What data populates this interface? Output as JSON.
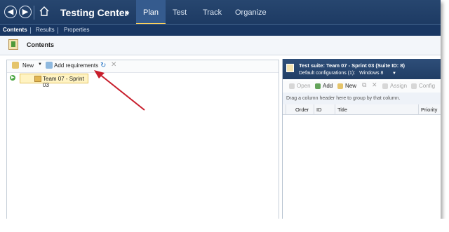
{
  "window": {
    "title": "Testing Center",
    "tabs": [
      "Plan",
      "Test",
      "Track",
      "Organize"
    ],
    "active_tab": "Plan",
    "subtabs": [
      "Contents",
      "Results",
      "Properties"
    ],
    "active_subtab": "Contents"
  },
  "page": {
    "heading": "Contents"
  },
  "left_toolbar": {
    "new_label": "New",
    "add_requirements_label": "Add requirements"
  },
  "tree": {
    "items": [
      "Team 07 - Sprint 03"
    ]
  },
  "suite": {
    "title": "Test suite:  Team 07 - Sprint 03 (Suite ID: 8)",
    "default_configs_label": "Default configurations (1):",
    "default_configs_value": "Windows 8"
  },
  "right_toolbar": {
    "open_label": "Open",
    "add_label": "Add",
    "new_label": "New",
    "assign_label": "Assign",
    "configure_label": "Config"
  },
  "group_hint": "Drag a column header here to group by that column.",
  "grid": {
    "columns": [
      "Order",
      "ID",
      "Title",
      "Priority"
    ]
  },
  "colors": {
    "header_bg": "#1d3a63",
    "accent": "#ffd25a",
    "annotation_arrow": "#c81e2c"
  }
}
